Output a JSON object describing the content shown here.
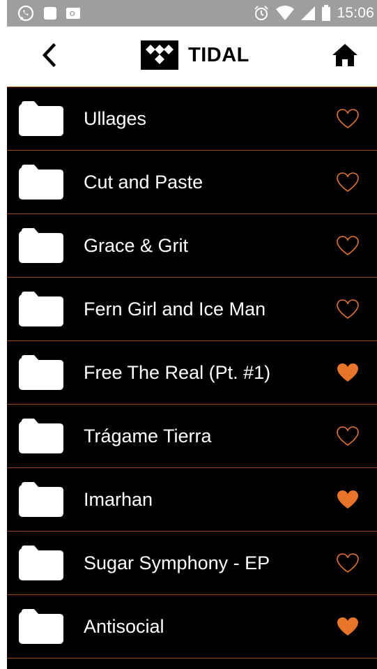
{
  "status_bar": {
    "time": "15:06",
    "icons": [
      "whatsapp-icon",
      "stop-icon",
      "outlook-icon",
      "alarm-icon",
      "wifi-icon",
      "signal-icon",
      "battery-icon"
    ]
  },
  "header": {
    "title": "TIDAL",
    "back_icon": "chevron-left-icon",
    "home_icon": "home-icon"
  },
  "colors": {
    "accent": "#e8742a",
    "background": "#000000",
    "divider": "#9c4a18",
    "status_bar": "#9e9e9e"
  },
  "items": [
    {
      "title": "Ullages",
      "favorite": false
    },
    {
      "title": "Cut and Paste",
      "favorite": false
    },
    {
      "title": "Grace & Grit",
      "favorite": false
    },
    {
      "title": "Fern Girl and Ice Man",
      "favorite": false
    },
    {
      "title": "Free The Real (Pt. #1)",
      "favorite": true
    },
    {
      "title": "Trágame Tierra",
      "favorite": false
    },
    {
      "title": "Imarhan",
      "favorite": true
    },
    {
      "title": "Sugar Symphony - EP",
      "favorite": false
    },
    {
      "title": "Antisocial",
      "favorite": true
    }
  ]
}
